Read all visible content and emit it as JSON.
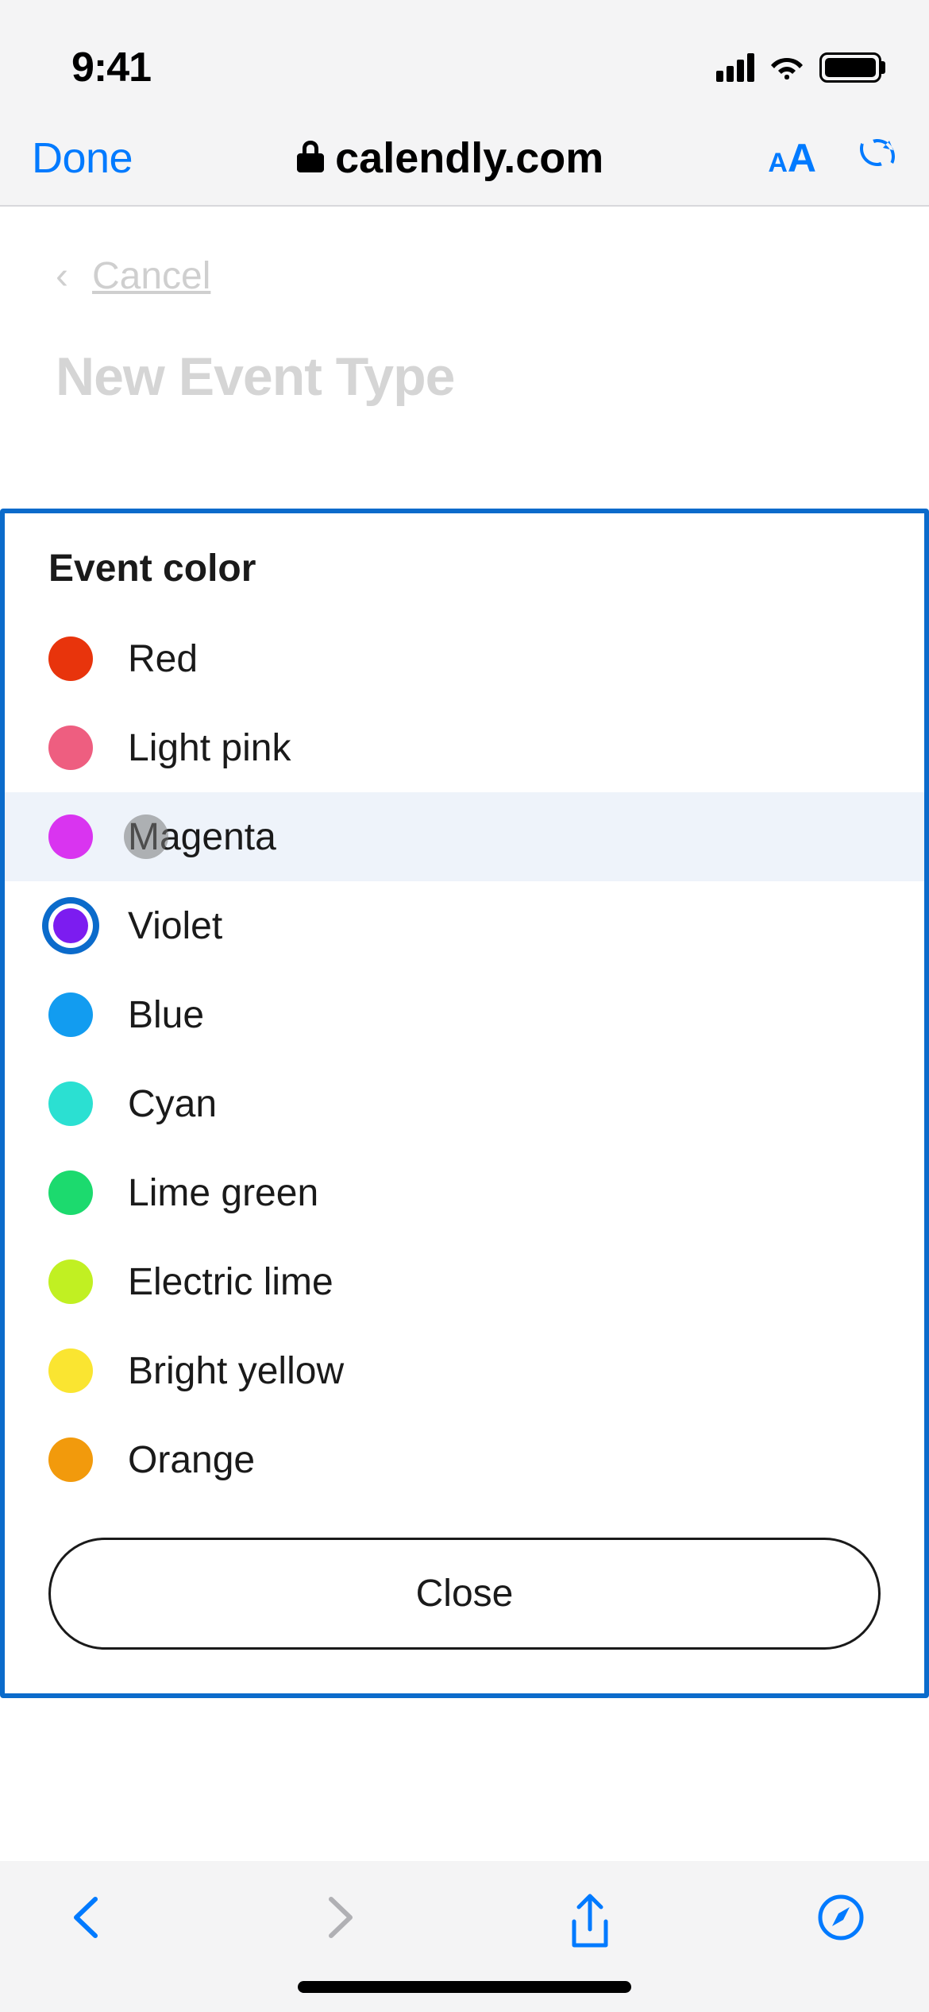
{
  "status": {
    "time": "9:41"
  },
  "browser": {
    "done_label": "Done",
    "url": "calendly.com"
  },
  "page": {
    "cancel_label": "Cancel",
    "title": "New Event Type"
  },
  "panel": {
    "heading": "Event color",
    "selected_index": 3,
    "highlighted_index": 2,
    "colors": [
      {
        "label": "Red",
        "hex": "#e8340c"
      },
      {
        "label": "Light pink",
        "hex": "#ee5e80"
      },
      {
        "label": "Magenta",
        "hex": "#d934f0"
      },
      {
        "label": "Violet",
        "hex": "#7c1cf0"
      },
      {
        "label": "Blue",
        "hex": "#129cf0"
      },
      {
        "label": "Cyan",
        "hex": "#2be0d2"
      },
      {
        "label": "Lime green",
        "hex": "#1cda6e"
      },
      {
        "label": "Electric lime",
        "hex": "#c1f022"
      },
      {
        "label": "Bright yellow",
        "hex": "#fae531"
      },
      {
        "label": "Orange",
        "hex": "#f29a0c"
      }
    ],
    "close_label": "Close"
  }
}
